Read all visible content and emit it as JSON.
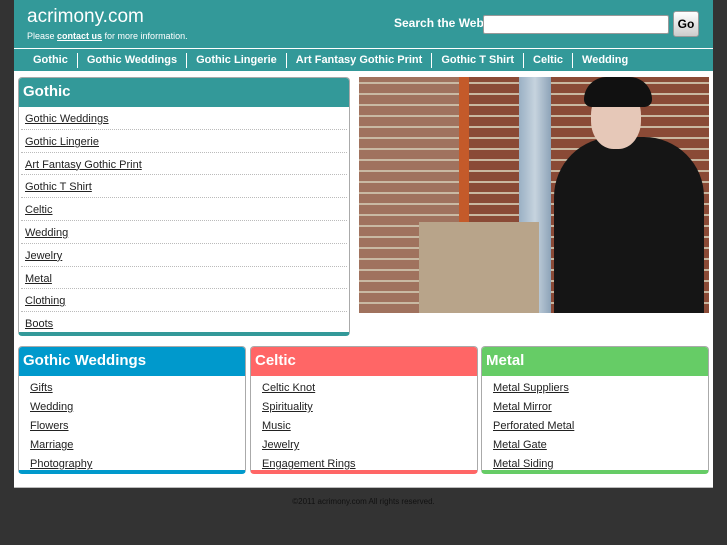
{
  "header": {
    "site": "acrimony.com",
    "tagline_pre": "Please ",
    "tagline_link": "contact us",
    "tagline_post": " for more information.",
    "search_label": "Search the Web:",
    "search_value": "",
    "go": "Go"
  },
  "nav": [
    "Gothic",
    "Gothic Weddings",
    "Gothic Lingerie",
    "Art Fantasy Gothic Print",
    "Gothic T Shirt",
    "Celtic",
    "Wedding"
  ],
  "gothic": {
    "title": "Gothic",
    "items": [
      "Gothic Weddings",
      "Gothic Lingerie",
      "Art Fantasy Gothic Print",
      "Gothic T Shirt",
      "Celtic",
      "Wedding",
      "Jewelry",
      "Metal",
      "Clothing",
      "Boots"
    ]
  },
  "categories": [
    {
      "title": "Gothic Weddings",
      "color": "#0099cc",
      "items": [
        "Gifts",
        "Wedding",
        "Flowers",
        "Marriage",
        "Photography"
      ]
    },
    {
      "title": "Celtic",
      "color": "#ff6666",
      "items": [
        "Celtic Knot",
        "Spirituality",
        "Music",
        "Jewelry",
        "Engagement Rings"
      ]
    },
    {
      "title": "Metal",
      "color": "#66cc66",
      "items": [
        "Metal Suppliers",
        "Metal Mirror",
        "Perforated Metal",
        "Metal Gate",
        "Metal Siding"
      ]
    }
  ],
  "footer": "©2011 acrimony.com All rights reserved.",
  "colors": {
    "brand": "#339999",
    "background": "#333333"
  }
}
